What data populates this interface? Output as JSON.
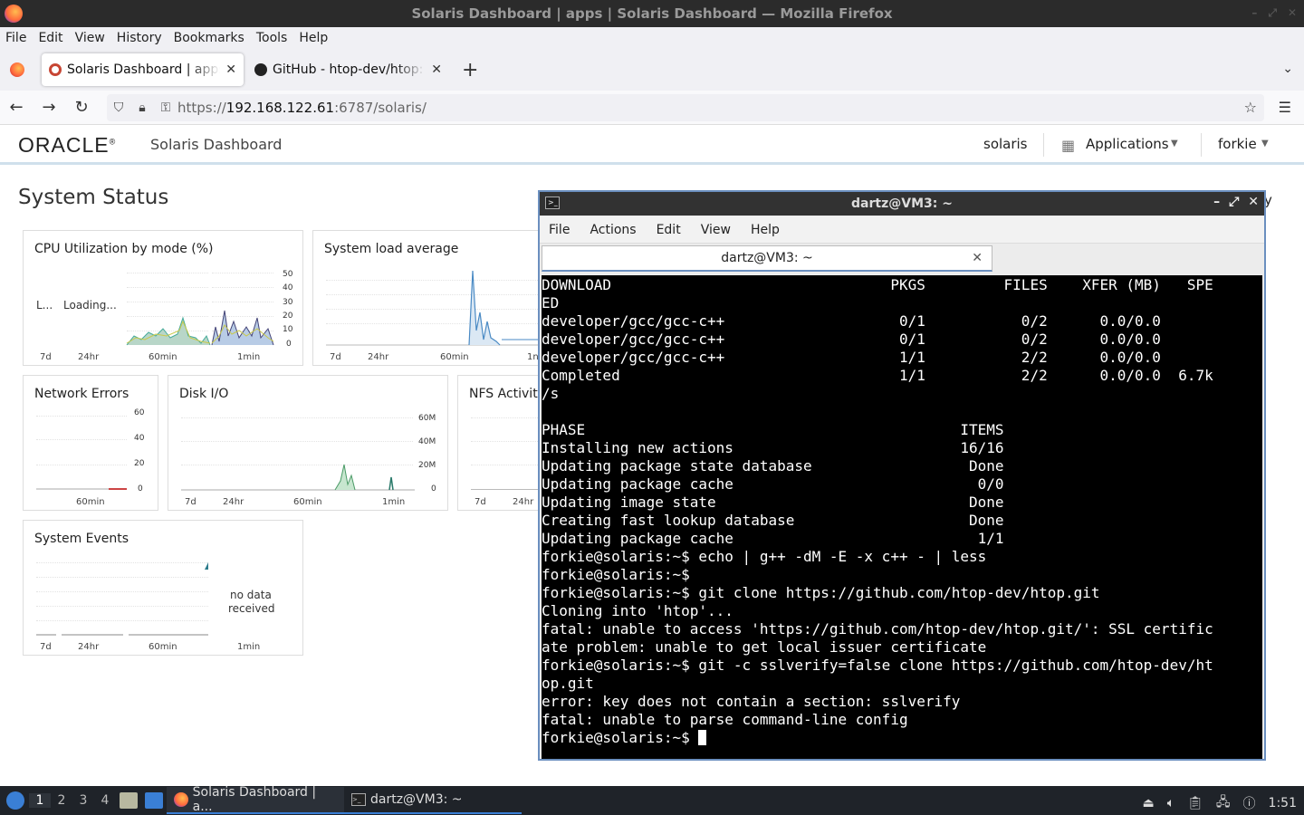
{
  "window": {
    "title": "Solaris Dashboard | apps | Solaris Dashboard — Mozilla Firefox"
  },
  "menu": [
    "File",
    "Edit",
    "View",
    "History",
    "Bookmarks",
    "Tools",
    "Help"
  ],
  "tabs": [
    {
      "label": "Solaris Dashboard | apps",
      "close": "✕"
    },
    {
      "label": "GitHub - htop-dev/htop: ",
      "close": "✕"
    }
  ],
  "newtab": "+",
  "url": {
    "scheme": "https://",
    "host": "192.168.122.61",
    "rest": ":6787/solaris/"
  },
  "header": {
    "logo": "ORACLE",
    "logo_mark": "®",
    "title": "Solaris Dashboard",
    "host": "solaris",
    "apps_label": "Applications",
    "account": "forkie"
  },
  "page": {
    "title": "System Status",
    "clipped_text": "y"
  },
  "cards": {
    "cpu": {
      "title": "CPU Utilization by mode (%)",
      "loading1": "L...",
      "loading2": "Loading...",
      "y": [
        "50",
        "40",
        "30",
        "20",
        "10",
        "0"
      ],
      "x": [
        "7d",
        "24hr",
        "60min",
        "1min"
      ]
    },
    "load": {
      "title": "System load average",
      "x": [
        "7d",
        "24hr",
        "60min",
        "1n"
      ]
    },
    "net": {
      "title": "Network Errors",
      "y": [
        "60",
        "40",
        "20",
        "0"
      ],
      "x": [
        "60min"
      ]
    },
    "disk": {
      "title": "Disk I/O",
      "y": [
        "60M",
        "40M",
        "20M",
        "0"
      ],
      "x": [
        "7d",
        "24hr",
        "60min",
        "1min"
      ]
    },
    "nfs": {
      "title": "NFS Activit",
      "x": [
        "7d",
        "24hr"
      ]
    },
    "events": {
      "title": "System Events",
      "nodata1": "no data",
      "nodata2": "received",
      "x": [
        "7d",
        "24hr",
        "60min",
        "1min"
      ]
    }
  },
  "terminal": {
    "title": "dartz@VM3: ~",
    "menu": [
      "File",
      "Actions",
      "Edit",
      "View",
      "Help"
    ],
    "tab": "dartz@VM3: ~",
    "lines": [
      "DOWNLOAD                                PKGS         FILES    XFER (MB)   SPE",
      "ED",
      "developer/gcc/gcc-c++                    0/1           0/2      0.0/0.0",
      "developer/gcc/gcc-c++                    0/1           0/2      0.0/0.0",
      "developer/gcc/gcc-c++                    1/1           2/2      0.0/0.0",
      "Completed                                1/1           2/2      0.0/0.0  6.7k",
      "/s",
      "",
      "PHASE                                           ITEMS",
      "Installing new actions                          16/16",
      "Updating package state database                  Done",
      "Updating package cache                            0/0",
      "Updating image state                             Done",
      "Creating fast lookup database                    Done",
      "Updating package cache                            1/1",
      "forkie@solaris:~$ echo | g++ -dM -E -x c++ - | less",
      "forkie@solaris:~$",
      "forkie@solaris:~$ git clone https://github.com/htop-dev/htop.git",
      "Cloning into 'htop'...",
      "fatal: unable to access 'https://github.com/htop-dev/htop.git/': SSL certific",
      "ate problem: unable to get local issuer certificate",
      "forkie@solaris:~$ git -c sslverify=false clone https://github.com/htop-dev/ht",
      "op.git",
      "error: key does not contain a section: sslverify",
      "fatal: unable to parse command-line config"
    ],
    "prompt": "forkie@solaris:~$ "
  },
  "taskbar": {
    "workspaces": [
      "1",
      "2",
      "3",
      "4"
    ],
    "tasks": [
      "Solaris Dashboard | a...",
      "dartz@VM3: ~"
    ],
    "clock": "1:51"
  }
}
